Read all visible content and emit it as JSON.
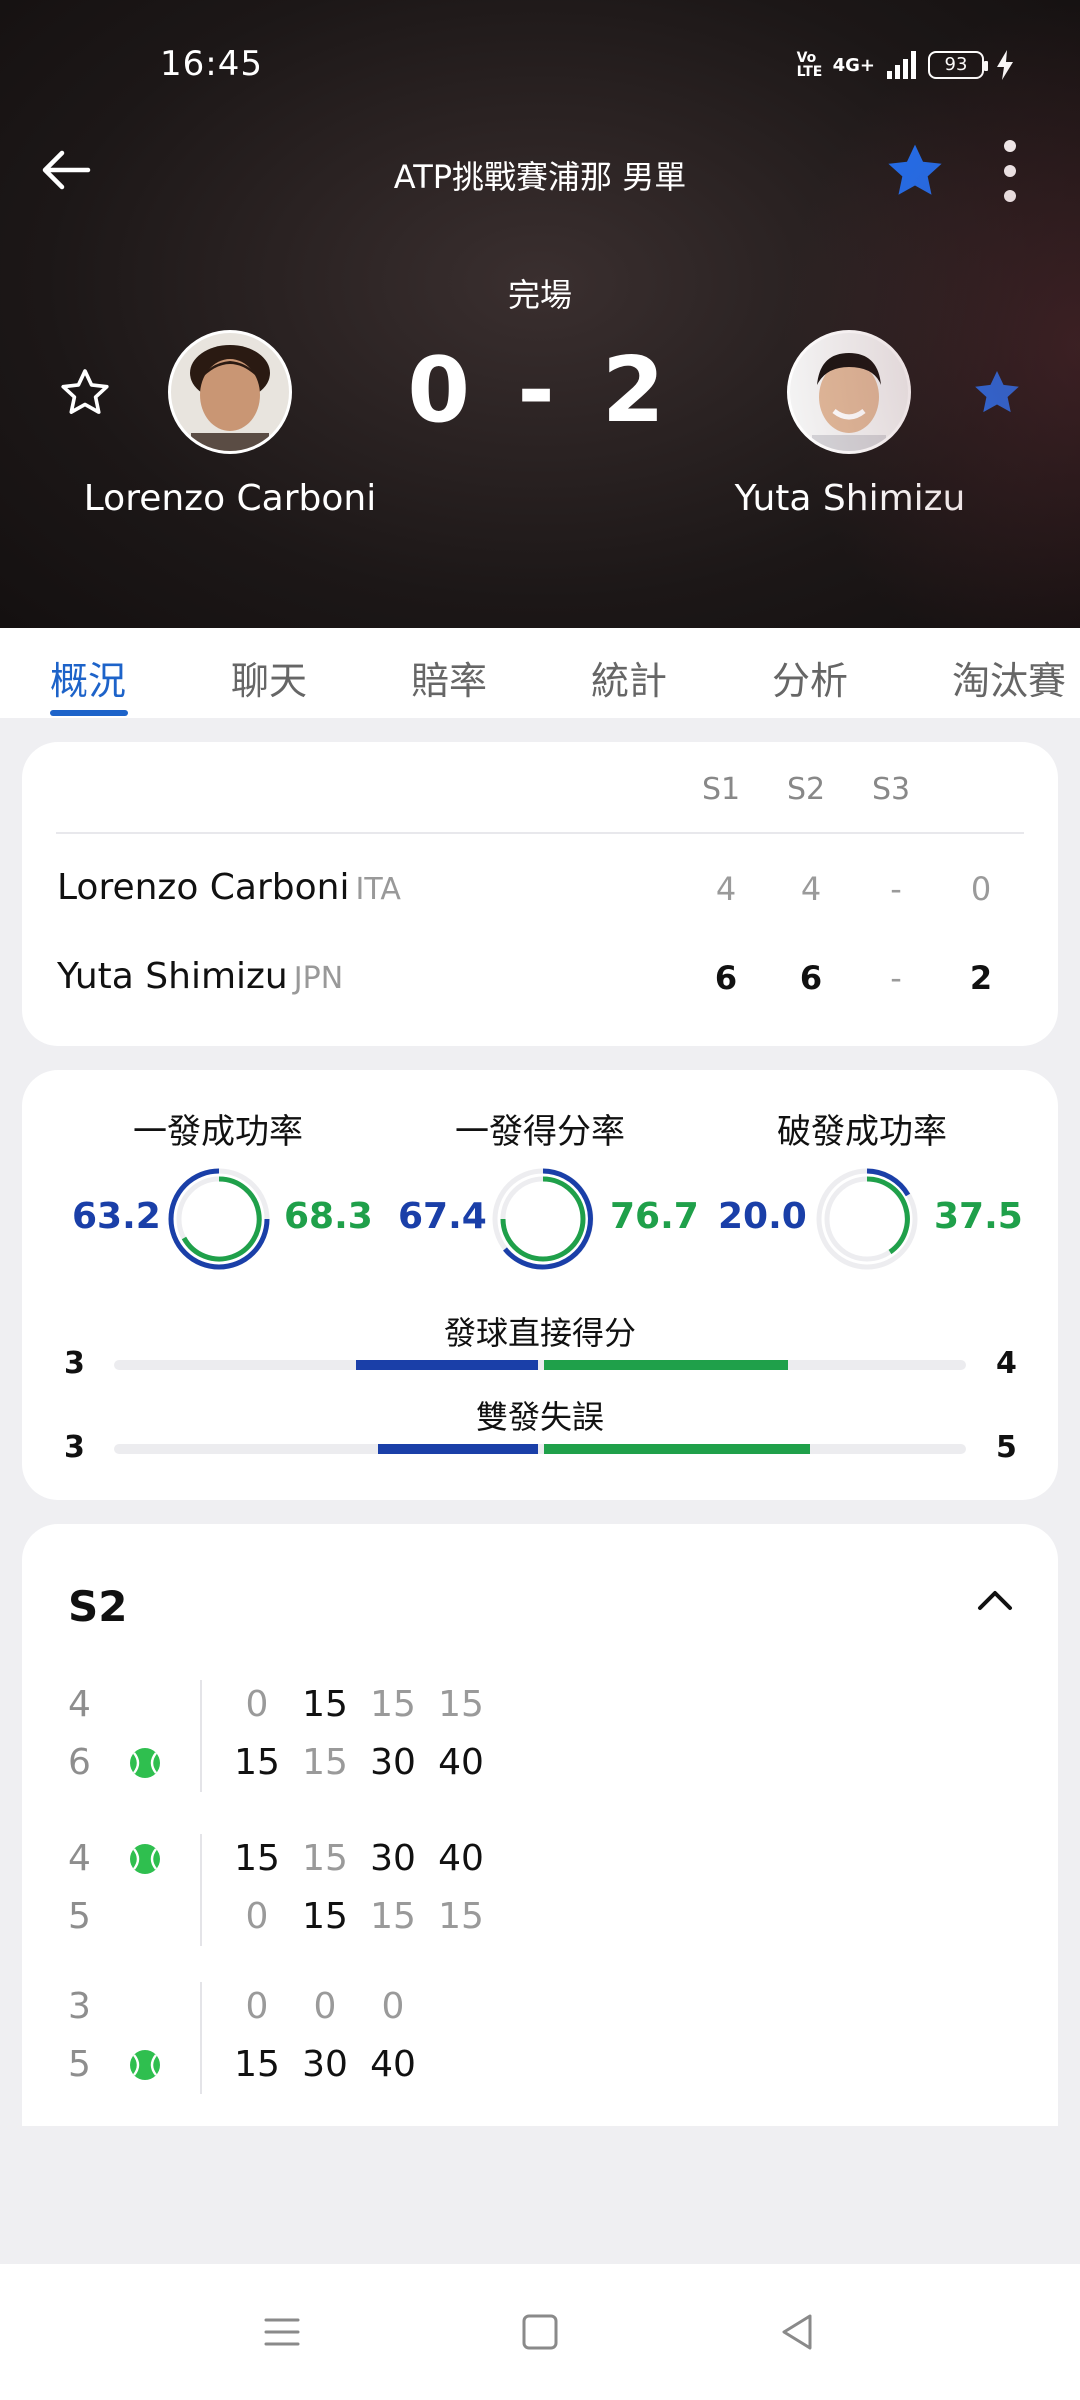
{
  "status_bar": {
    "time": "16:45",
    "network": "4G+",
    "volte": "Vo LTE",
    "battery": "93"
  },
  "header": {
    "title": "ATP挑戰賽浦那 男單",
    "match_status": "完場",
    "score": "0 - 2",
    "player_left": "Lorenzo Carboni",
    "player_right": "Yuta Shimizu"
  },
  "tabs": [
    "概況",
    "聊天",
    "賠率",
    "統計",
    "分析",
    "淘汰賽"
  ],
  "sets_card": {
    "headers": [
      "S1",
      "S2",
      "S3"
    ],
    "rows": [
      {
        "name": "Lorenzo Carboni",
        "country": "ITA",
        "sets": [
          "4",
          "4",
          "-"
        ],
        "total": "0"
      },
      {
        "name": "Yuta Shimizu",
        "country": "JPN",
        "sets": [
          "6",
          "6",
          "-"
        ],
        "total": "2"
      }
    ]
  },
  "stats_card": {
    "rings": [
      {
        "label": "一發成功率",
        "left": "63.2",
        "right": "68.3"
      },
      {
        "label": "一發得分率",
        "left": "67.4",
        "right": "76.7"
      },
      {
        "label": "破發成功率",
        "left": "20.0",
        "right": "37.5"
      }
    ],
    "bars": [
      {
        "label": "發球直接得分",
        "left": "3",
        "right": "4"
      },
      {
        "label": "雙發失誤",
        "left": "3",
        "right": "5"
      }
    ]
  },
  "set_detail": {
    "title": "S2",
    "games": [
      {
        "top": {
          "games": "4",
          "serve": false,
          "points": [
            "0",
            "15",
            "15",
            "15"
          ]
        },
        "bottom": {
          "games": "6",
          "serve": true,
          "points": [
            "15",
            "15",
            "30",
            "40"
          ]
        }
      },
      {
        "top": {
          "games": "4",
          "serve": true,
          "points": [
            "15",
            "15",
            "30",
            "40"
          ]
        },
        "bottom": {
          "games": "5",
          "serve": false,
          "points": [
            "0",
            "15",
            "15",
            "15"
          ]
        }
      },
      {
        "top": {
          "games": "3",
          "serve": false,
          "points": [
            "0",
            "0",
            "0"
          ]
        },
        "bottom": {
          "games": "5",
          "serve": true,
          "points": [
            "15",
            "30",
            "40"
          ]
        }
      }
    ]
  },
  "colors": {
    "accent": "#1d63c9",
    "player_left": "#1a3fa8",
    "player_right": "#1fa04a",
    "star": "#1f6ff0"
  }
}
